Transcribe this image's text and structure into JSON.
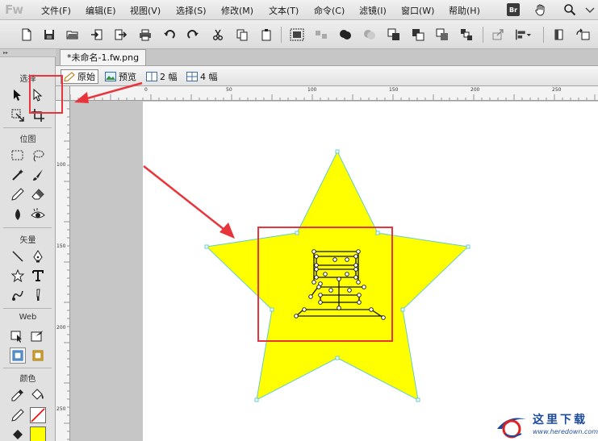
{
  "app": {
    "logo": "Fw"
  },
  "menu": {
    "items": [
      "文件(F)",
      "编辑(E)",
      "视图(V)",
      "选择(S)",
      "修改(M)",
      "文本(T)",
      "命令(C)",
      "滤镜(I)",
      "窗口(W)",
      "帮助(H)"
    ],
    "bridge_label": "Br"
  },
  "tools_panel": {
    "grip_label": "▸▸",
    "sections": {
      "select": "选择",
      "bitmap": "位图",
      "vector": "矢量",
      "web": "Web",
      "colors": "颜色"
    },
    "fill_color": "#ffff00",
    "stroke_color": "#ff0000"
  },
  "document": {
    "tab_title": "*未命名-1.fw.png",
    "view_tabs": [
      {
        "label": "原始",
        "active": true
      },
      {
        "label": "预览",
        "active": false
      },
      {
        "label": "2 幅",
        "active": false
      },
      {
        "label": "4 幅",
        "active": false
      }
    ],
    "ruler_top_labels": [
      "0",
      "50",
      "100",
      "150",
      "200",
      "250"
    ],
    "ruler_left_labels": [
      "100",
      "150",
      "200",
      "250"
    ],
    "canvas_color": "#ffffff"
  },
  "artwork": {
    "star_fill": "#ffff00",
    "star_stroke": "#66cccc",
    "glyph_text": "星"
  },
  "annotations": {
    "highlight_color": "#e8353c"
  },
  "watermark": {
    "text": "这里下载",
    "url": "www.heredown.com"
  }
}
